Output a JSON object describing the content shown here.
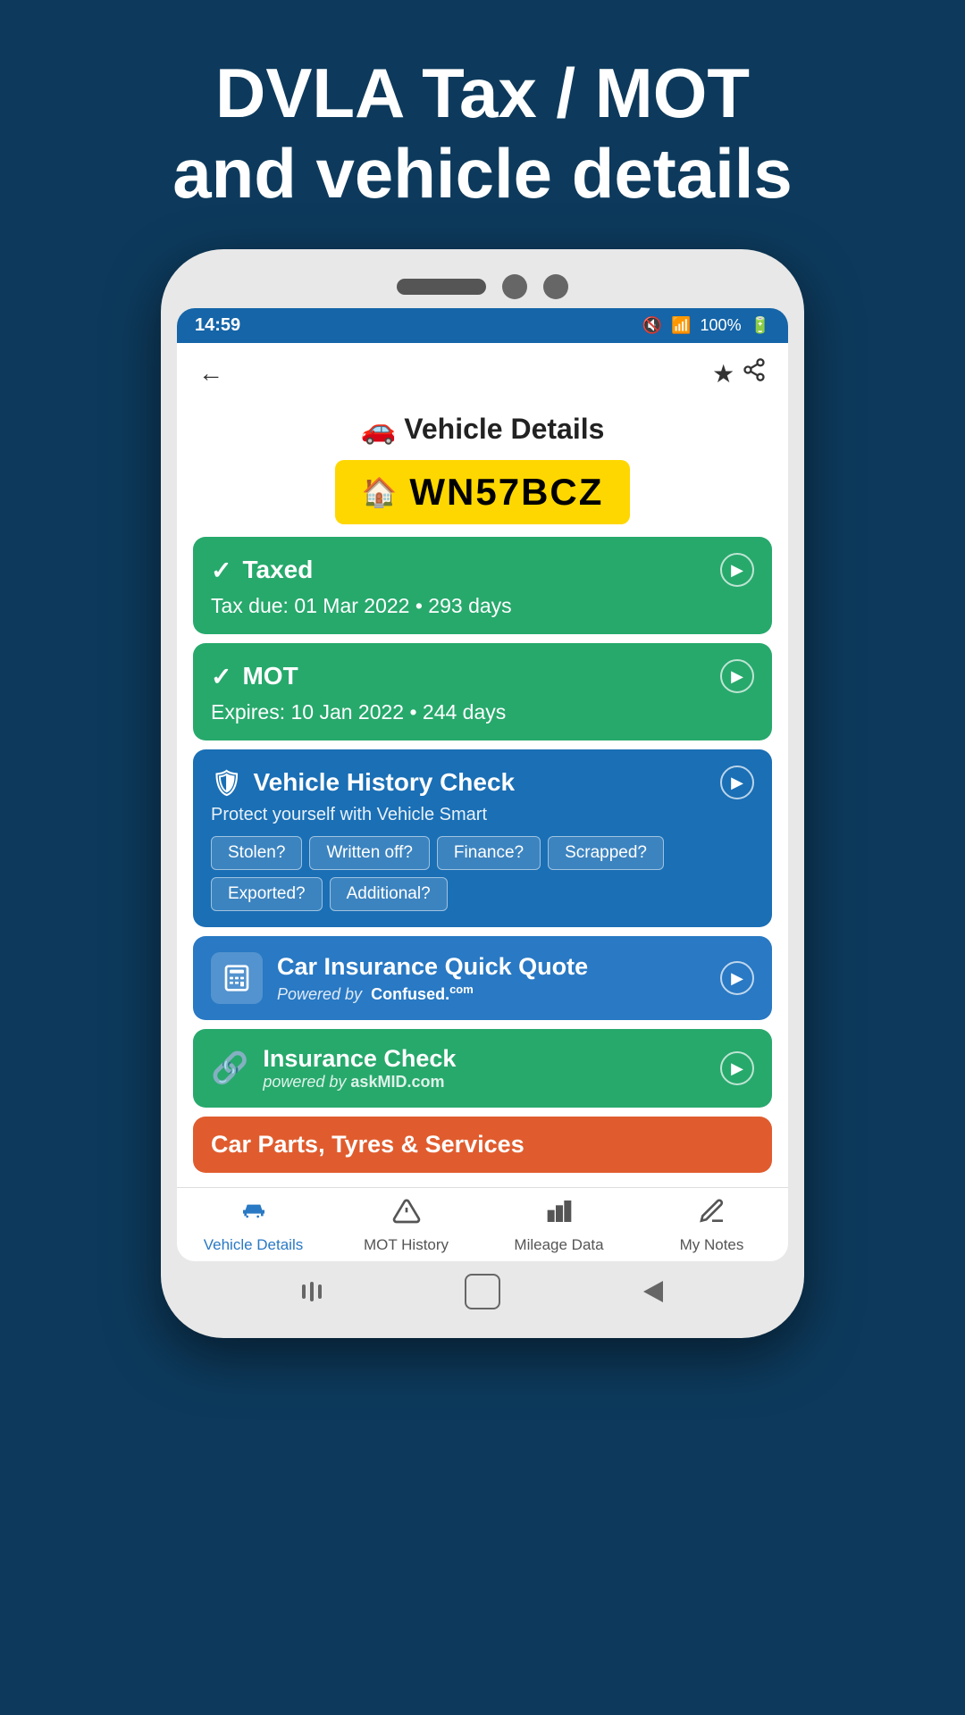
{
  "page": {
    "header_line1": "DVLA Tax / MOT",
    "header_line2": "and vehicle details"
  },
  "status_bar": {
    "time": "14:59",
    "battery": "100%"
  },
  "app_header": {
    "back_label": "‹",
    "share_label": "⋮"
  },
  "vehicle": {
    "page_title": "🚗 Vehicle Details",
    "plate_icon": "🏠",
    "plate_number": "WN57BCZ"
  },
  "cards": {
    "taxed": {
      "title": "Taxed",
      "subtitle": "Tax due: 01 Mar 2022 • 293 days"
    },
    "mot": {
      "title": "MOT",
      "subtitle": "Expires: 10 Jan 2022 • 244 days"
    },
    "history_check": {
      "title": "Vehicle History Check",
      "description": "Protect yourself with Vehicle Smart",
      "tags": [
        "Stolen?",
        "Written off?",
        "Finance?",
        "Scrapped?",
        "Exported?",
        "Additional?"
      ]
    },
    "car_insurance": {
      "title": "Car Insurance Quick Quote",
      "powered_by": "Powered by",
      "brand": "Confused.",
      "brand_suffix": "com"
    },
    "insurance_check": {
      "title": "Insurance Check",
      "powered_by": "powered by",
      "brand": "askMID.com"
    },
    "car_parts": {
      "title": "Car Parts, Tyres & Services"
    }
  },
  "bottom_nav": {
    "items": [
      {
        "id": "vehicle-details",
        "label": "Vehicle Details",
        "active": true,
        "icon": "car"
      },
      {
        "id": "mot-history",
        "label": "MOT History",
        "active": false,
        "icon": "warning"
      },
      {
        "id": "mileage-data",
        "label": "Mileage Data",
        "active": false,
        "icon": "bar-chart"
      },
      {
        "id": "my-notes",
        "label": "My Notes",
        "active": false,
        "icon": "pencil"
      }
    ]
  }
}
